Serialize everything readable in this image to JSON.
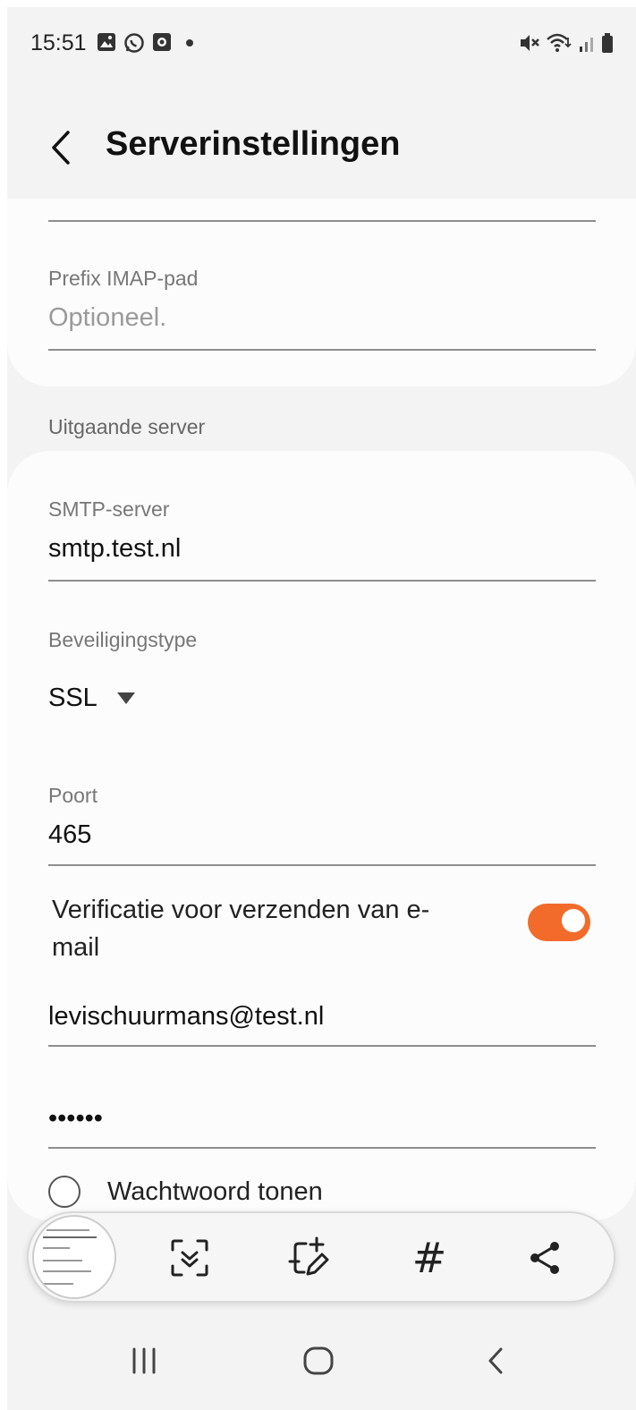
{
  "status_bar": {
    "time": "15:51",
    "icons": [
      "gallery-icon",
      "whatsapp-icon",
      "app-icon",
      "mute-icon",
      "wifi-icon",
      "signal-icon",
      "battery-icon"
    ]
  },
  "header": {
    "title": "Serverinstellingen"
  },
  "incoming": {
    "imap_prefix_label": "Prefix IMAP-pad",
    "imap_prefix_placeholder": "Optioneel."
  },
  "outgoing": {
    "section_label": "Uitgaande server",
    "smtp_label": "SMTP-server",
    "smtp_value": "smtp.test.nl",
    "security_label": "Beveiligingstype",
    "security_value": "SSL",
    "port_label": "Poort",
    "port_value": "465",
    "auth_label": "Verificatie voor verzenden van e-mail",
    "auth_enabled": true,
    "username_value": "levischuurmans@test.nl",
    "password_value": "••••••",
    "show_password_label": "Wachtwoord tonen",
    "show_password_checked": false
  },
  "toolbar": {
    "buttons": [
      "screenshot-thumbnail",
      "scroll-capture-icon",
      "draw-icon",
      "tag-hash-icon",
      "share-icon"
    ],
    "hash_symbol": "#"
  },
  "colors": {
    "accent": "#f26b2a",
    "background": "#f3f3f3",
    "card": "#fcfcfc"
  }
}
